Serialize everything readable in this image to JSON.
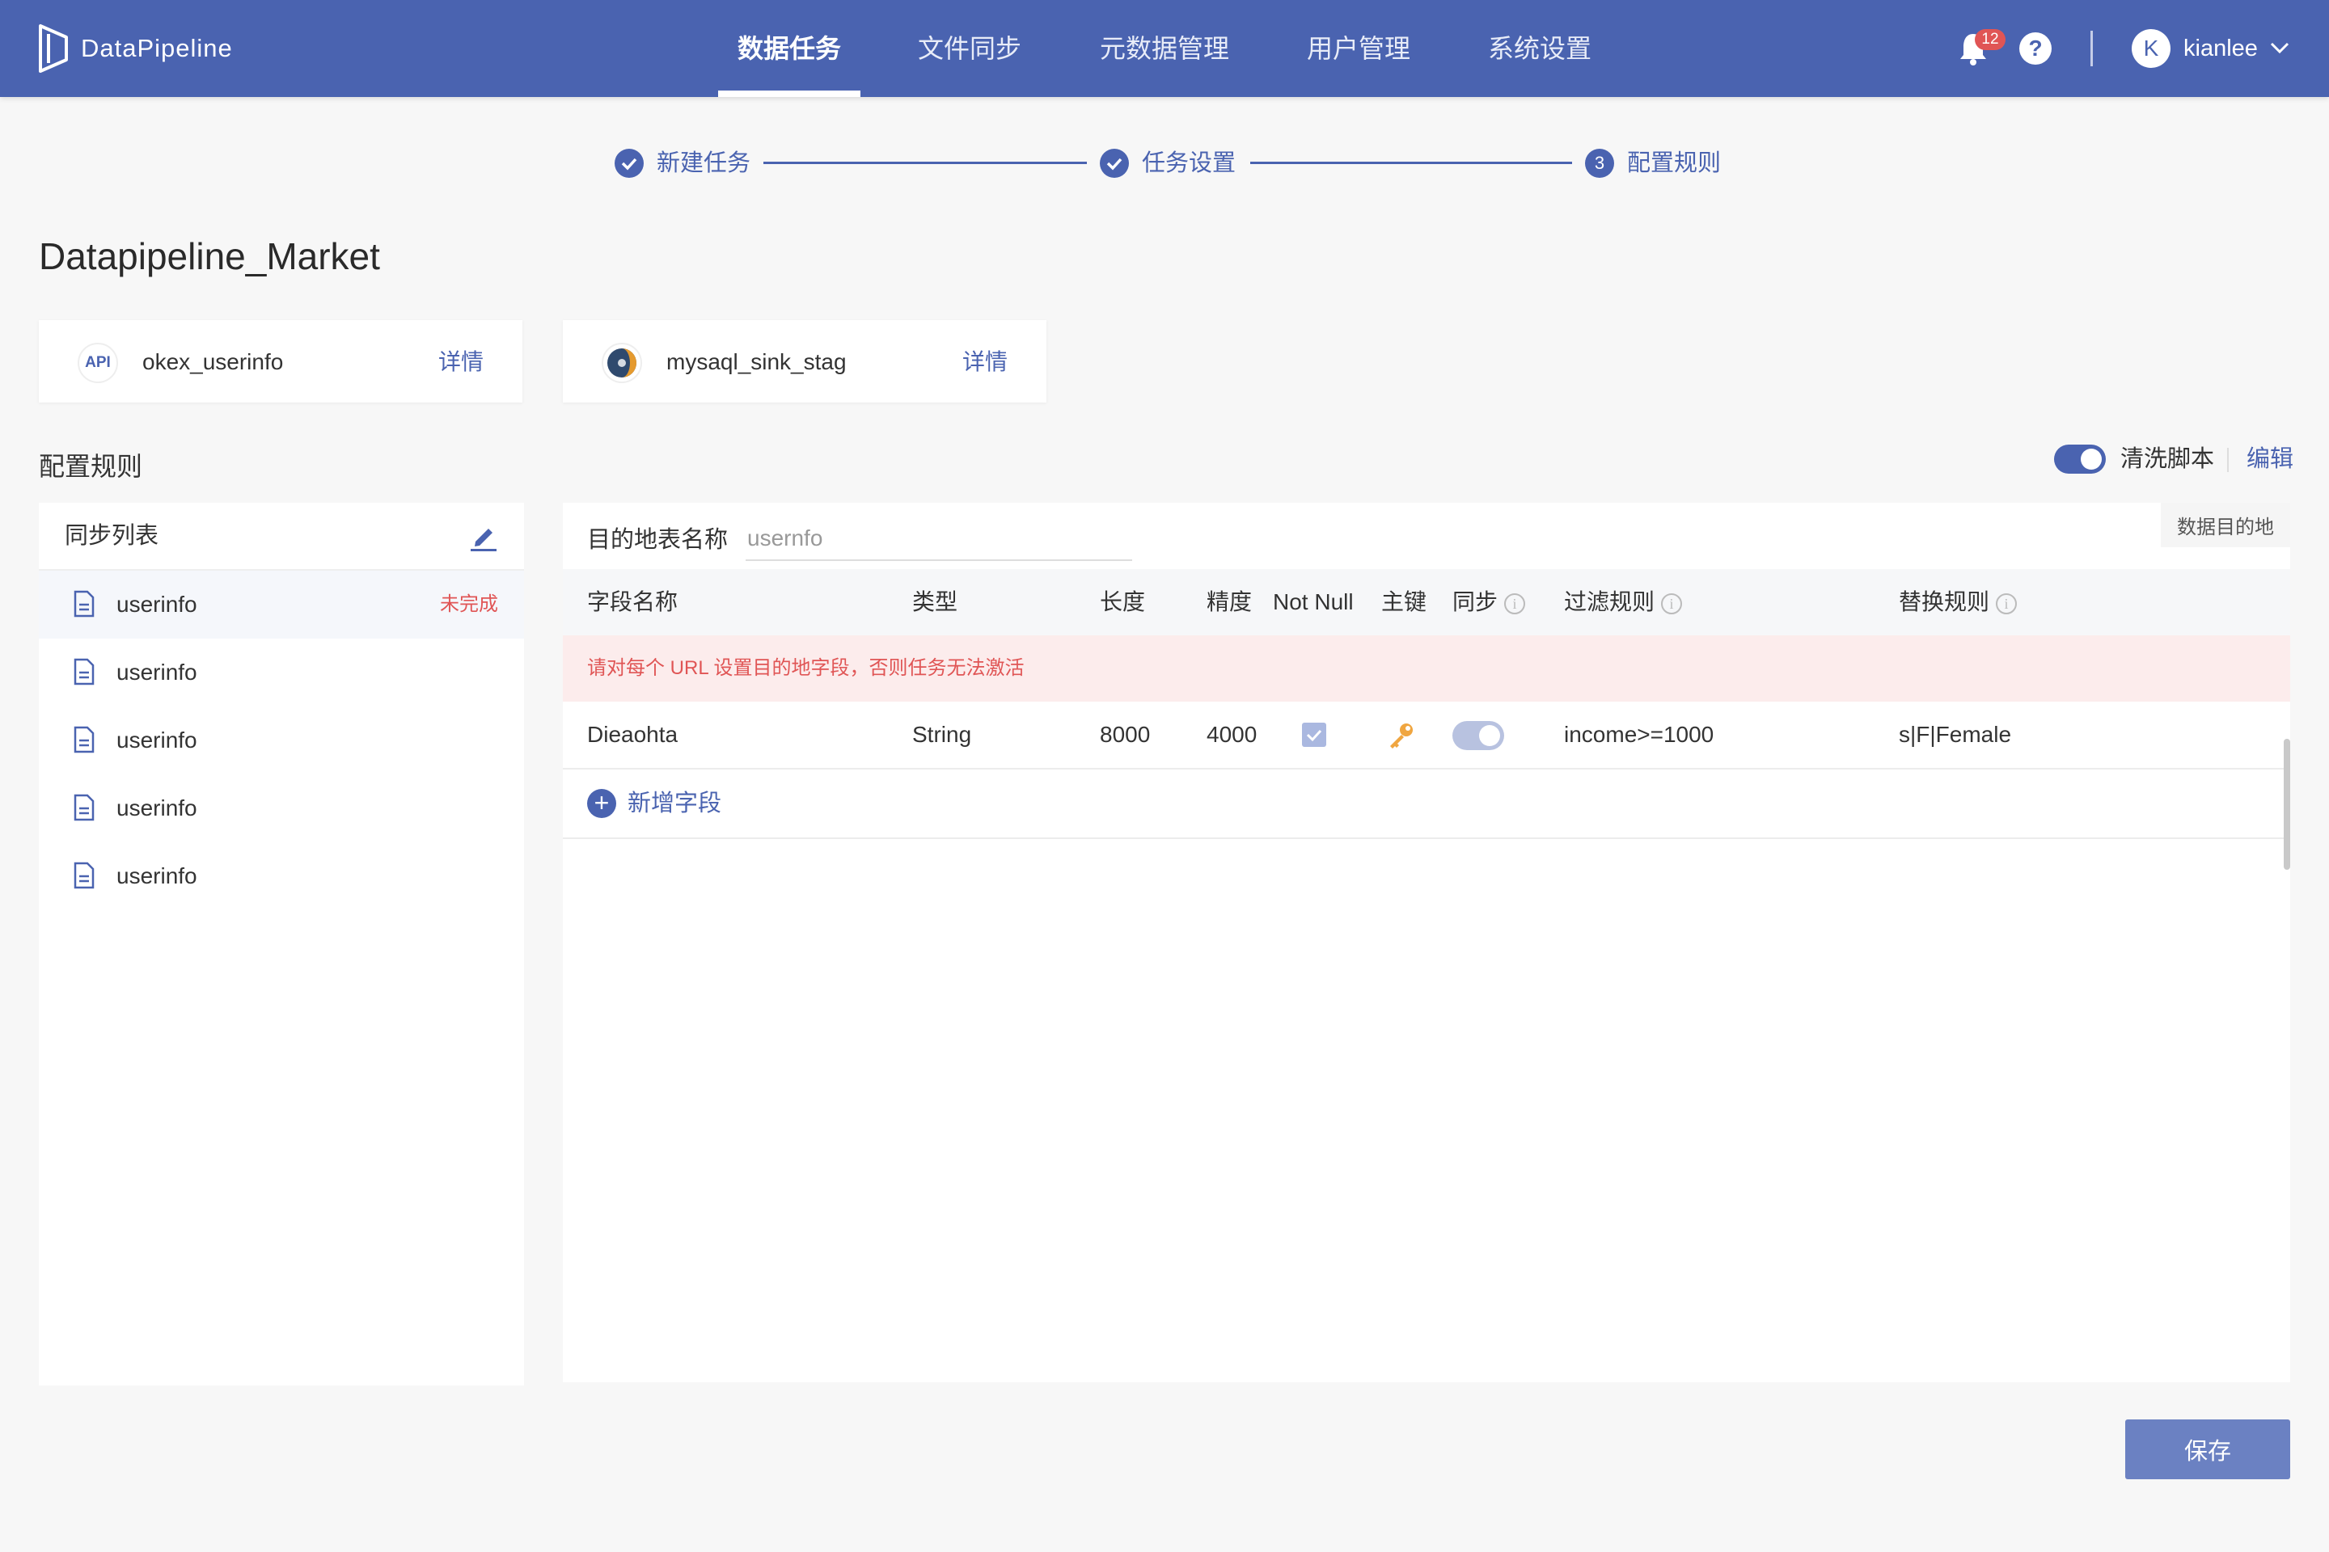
{
  "app": {
    "name": "DataPipeline"
  },
  "nav": {
    "items": [
      {
        "label": "数据任务",
        "active": true
      },
      {
        "label": "文件同步"
      },
      {
        "label": "元数据管理"
      },
      {
        "label": "用户管理"
      },
      {
        "label": "系统设置"
      }
    ],
    "notifications": "12",
    "help": "?",
    "user": {
      "initial": "K",
      "name": "kianlee"
    }
  },
  "stepper": {
    "steps": [
      {
        "label": "新建任务",
        "state": "done"
      },
      {
        "label": "任务设置",
        "state": "done"
      },
      {
        "label": "配置规则",
        "state": "current",
        "number": "3"
      }
    ]
  },
  "page": {
    "title": "Datapipeline_Market"
  },
  "source_cards": [
    {
      "icon": "API",
      "name": "okex_userinfo",
      "detail": "详情"
    },
    {
      "icon": "mysql-icon",
      "name": "mysaql_sink_stag",
      "detail": "详情"
    }
  ],
  "section": {
    "title": "配置规则",
    "wash_toggle_on": true,
    "wash_label": "清洗脚本",
    "edit_label": "编辑"
  },
  "sync_list": {
    "title": "同步列表",
    "items": [
      {
        "name": "userinfo",
        "status": "未完成"
      },
      {
        "name": "userinfo",
        "status": ""
      },
      {
        "name": "userinfo",
        "status": ""
      },
      {
        "name": "userinfo",
        "status": ""
      },
      {
        "name": "userinfo",
        "status": ""
      }
    ]
  },
  "config": {
    "target_label": "目的地表名称",
    "target_value": "usernfo",
    "dest_tag": "数据目的地",
    "headers": [
      "字段名称",
      "类型",
      "长度",
      "精度",
      "Not Null",
      "主键",
      "同步",
      "过滤规则",
      "替换规则"
    ],
    "warning": "请对每个 URL 设置目的地字段，否则任务无法激活",
    "rows": [
      {
        "name": "Dieaohta",
        "type": "String",
        "length": "8000",
        "precision": "4000",
        "not_null": true,
        "primary_key": true,
        "sync": true,
        "filter": "income>=1000",
        "replace": "s|F|Female"
      }
    ],
    "add_label": "新增字段"
  },
  "footer": {
    "save_label": "保存"
  },
  "colors": {
    "primary": "#4a63b0",
    "danger": "#e05555",
    "save": "#6b81c2"
  }
}
